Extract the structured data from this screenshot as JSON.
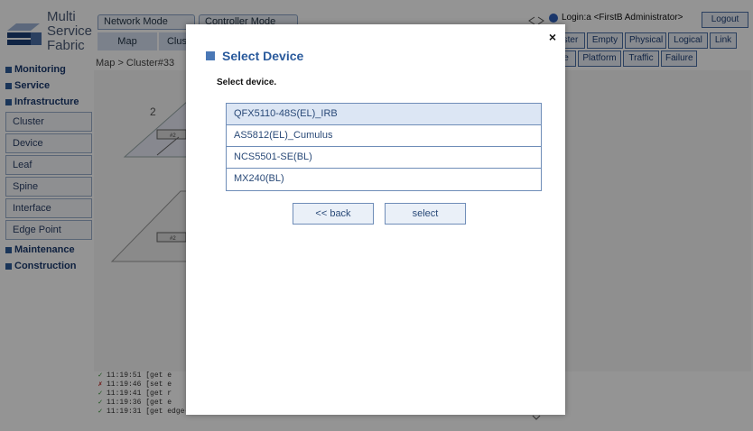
{
  "logo": {
    "line1": "Multi",
    "line2": "Service",
    "line3": "Fabric"
  },
  "sidebar": {
    "sections": [
      {
        "label": "Monitoring"
      },
      {
        "label": "Service"
      },
      {
        "label": "Infrastructure"
      }
    ],
    "items": [
      {
        "label": "Cluster"
      },
      {
        "label": "Device"
      },
      {
        "label": "Leaf"
      },
      {
        "label": "Spine"
      },
      {
        "label": "Interface"
      },
      {
        "label": "Edge Point"
      }
    ],
    "sections_bottom": [
      {
        "label": "Maintenance"
      },
      {
        "label": "Construction"
      }
    ]
  },
  "topbar": {
    "mode_tabs": [
      "Network Mode",
      "Controller Mode"
    ],
    "subtabs": [
      "Map",
      "Clus"
    ],
    "breadcrumb": "Map  > Cluster#33"
  },
  "header": {
    "login": "Login:a <FirstB Administrator>",
    "logout": "Logout",
    "view_buttons": [
      "ster",
      "Empty",
      "Physical",
      "Logical",
      "Link"
    ],
    "filter_buttons": [
      "e",
      "Platform",
      "Traffic",
      "Failure"
    ]
  },
  "map": {
    "node_labels": [
      "#2",
      "#2"
    ],
    "number": "2"
  },
  "log": [
    {
      "status": "ok",
      "time": "11:19:51",
      "text": "[get e"
    },
    {
      "status": "err",
      "time": "11:19:46",
      "text": "[set e"
    },
    {
      "status": "ok",
      "time": "11:19:41",
      "text": "[get r"
    },
    {
      "status": "ok",
      "time": "11:19:36",
      "text": "[get e"
    },
    {
      "status": "ok",
      "time": "11:19:31",
      "text": "[get edge-point]        Request Succeeded"
    }
  ],
  "modal": {
    "close": "×",
    "title": "Select Device",
    "instruction": "Select device.",
    "devices": [
      "QFX5110-48S(EL)_IRB",
      "AS5812(EL)_Cumulus",
      "NCS5501-SE(BL)",
      "MX240(BL)"
    ],
    "back_label": "<< back",
    "select_label": "select"
  }
}
